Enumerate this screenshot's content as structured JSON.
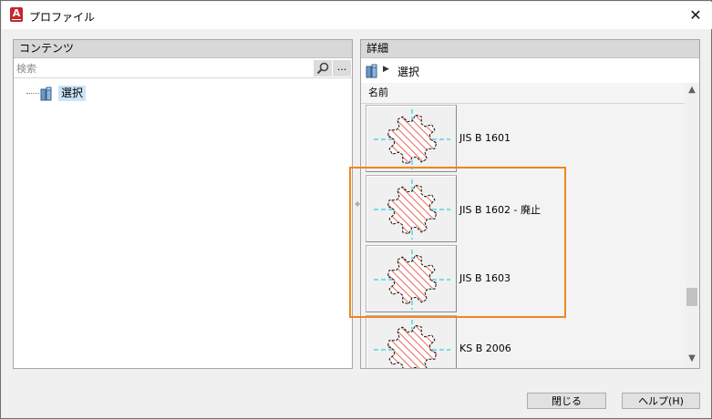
{
  "window": {
    "title": "プロファイル",
    "app_icon": "A",
    "close_glyph": "✕"
  },
  "contents_panel": {
    "header": "コンテンツ",
    "search_placeholder": "検索",
    "more_label": "...",
    "tree_items": [
      {
        "label": "選択",
        "icon": "profile-folder-icon"
      }
    ]
  },
  "details_panel": {
    "header": "詳細",
    "breadcrumb": "選択",
    "column_header": "名前",
    "rows": [
      {
        "label": "JIS B 1601"
      },
      {
        "label": "JIS B 1602 - 廃止"
      },
      {
        "label": "JIS B 1603"
      },
      {
        "label": "KS B 2006"
      }
    ],
    "scroll_position": 0.8
  },
  "buttons": {
    "close": "閉じる",
    "help": "ヘルプ(H)"
  },
  "colors": {
    "highlight": "#f0861d",
    "hatch": "#e8402e",
    "centerline": "#00c8e0",
    "selection": "#cce4f7"
  }
}
